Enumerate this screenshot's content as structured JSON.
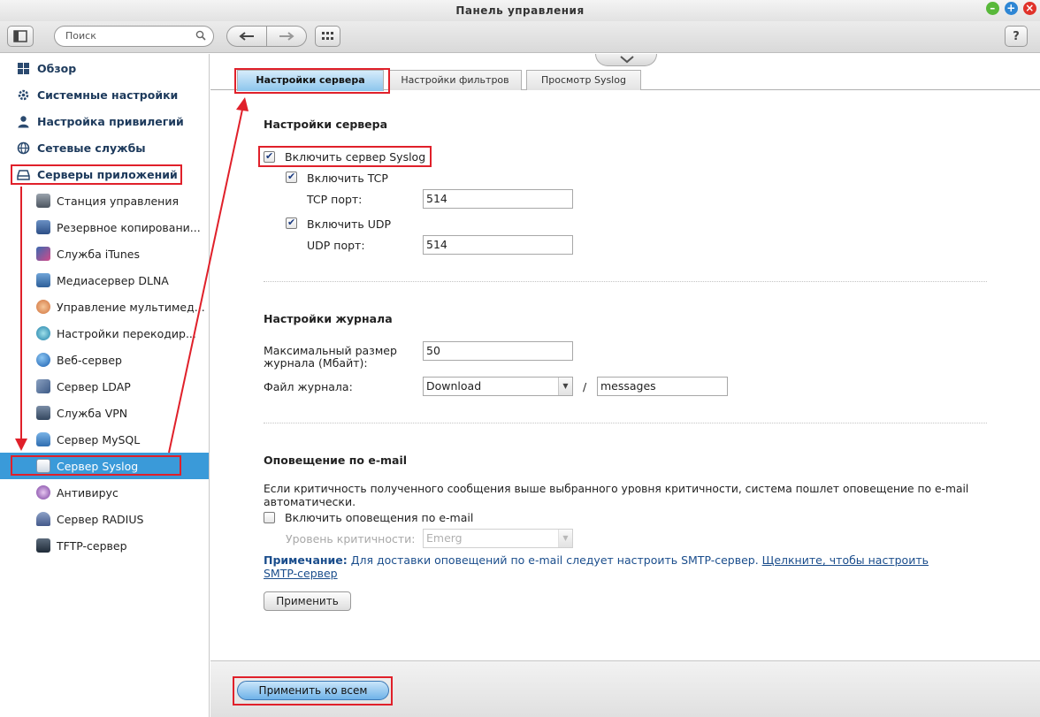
{
  "window": {
    "title": "Панель управления",
    "controls": [
      "minimize-icon",
      "maximize-icon",
      "close-icon"
    ]
  },
  "toolbar": {
    "search_placeholder": "Поиск",
    "help_label": "?"
  },
  "sidebar": {
    "top_items": [
      {
        "label": "Обзор",
        "icon": "overview-grid-icon"
      },
      {
        "label": "Системные настройки",
        "icon": "gear-icon"
      },
      {
        "label": "Настройка привилегий",
        "icon": "user-icon"
      },
      {
        "label": "Сетевые службы",
        "icon": "network-globe-icon"
      },
      {
        "label": "Серверы приложений",
        "icon": "app-server-icon"
      }
    ],
    "sub_items": [
      {
        "label": "Станция управления",
        "icon": "station-icon"
      },
      {
        "label": "Резервное копировани...",
        "icon": "backup-icon"
      },
      {
        "label": "Служба iTunes",
        "icon": "itunes-icon"
      },
      {
        "label": "Медиасервер DLNA",
        "icon": "dlna-icon"
      },
      {
        "label": "Управление мультимед...",
        "icon": "multimedia-icon"
      },
      {
        "label": "Настройки перекодир...",
        "icon": "transcode-icon"
      },
      {
        "label": "Веб-сервер",
        "icon": "web-server-icon"
      },
      {
        "label": "Сервер LDAP",
        "icon": "ldap-icon"
      },
      {
        "label": "Служба VPN",
        "icon": "vpn-icon"
      },
      {
        "label": "Сервер MySQL",
        "icon": "mysql-icon"
      },
      {
        "label": "Сервер Syslog",
        "icon": "syslog-icon",
        "selected": true
      },
      {
        "label": "Антивирус",
        "icon": "antivirus-icon"
      },
      {
        "label": "Сервер RADIUS",
        "icon": "radius-icon"
      },
      {
        "label": "TFTP-сервер",
        "icon": "tftp-icon"
      }
    ]
  },
  "tabs": [
    {
      "label": "Настройки сервера",
      "active": true
    },
    {
      "label": "Настройки фильтров",
      "active": false
    },
    {
      "label": "Просмотр Syslog",
      "active": false
    }
  ],
  "server_settings": {
    "title": "Настройки сервера",
    "enable_syslog_label": "Включить сервер Syslog",
    "enable_syslog_checked": true,
    "enable_tcp_label": "Включить TCP",
    "enable_tcp_checked": true,
    "tcp_port_label": "TCP порт:",
    "tcp_port_value": "514",
    "enable_udp_label": "Включить UDP",
    "enable_udp_checked": true,
    "udp_port_label": "UDP порт:",
    "udp_port_value": "514"
  },
  "log_settings": {
    "title": "Настройки журнала",
    "max_size_label_line1": "Максимальный размер",
    "max_size_label_line2": "журнала (Мбайт):",
    "max_size_value": "50",
    "log_file_label": "Файл журнала:",
    "log_folder_value": "Download",
    "separator": "/",
    "log_file_value": "messages"
  },
  "email_alert": {
    "title": "Оповещение по e-mail",
    "description_line1": "Если критичность полученного сообщения выше выбранного уровня критичности, система пошлет оповещение по e-mail",
    "description_line2": "автоматически.",
    "enable_label": "Включить оповещения по e-mail",
    "enable_checked": false,
    "severity_label": "Уровень критичности:",
    "severity_value": "Emerg",
    "note_prefix": "Примечание:",
    "note_text": " Для доставки оповещений по e-mail следует настроить SMTP-сервер. ",
    "note_link_part1": "Щелкните, чтобы настроить",
    "note_link_part2": "SMTP-сервер",
    "apply_label": "Применить"
  },
  "footer": {
    "apply_all_label": "Применить ко всем"
  },
  "colors": {
    "selected_item": "#3a9ad9",
    "highlight_annotation": "#e0202a",
    "active_tab": "#8cc5ec",
    "heading_text": "#1d3a5c",
    "link": "#1a4d8c"
  }
}
